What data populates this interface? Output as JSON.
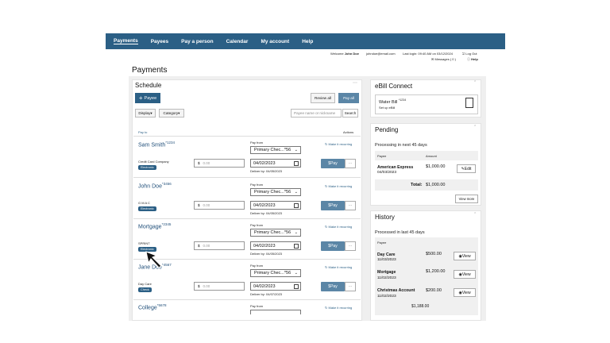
{
  "nav": [
    "Payments",
    "Payees",
    "Pay a person",
    "Calendar",
    "My account",
    "Help"
  ],
  "util": {
    "welcome_prefix": "Welcome",
    "welcome_name": "John Doe",
    "email": "johndoe@email.com",
    "last_login": "Last login: 09:40 AM on 03/12/2024",
    "logout": "Log Out",
    "messages": "Messages ( 0 )",
    "help": "Help"
  },
  "page_title": "Payments",
  "schedule": {
    "title": "Schedule",
    "add_payee": "Payee",
    "review_all": "Review all",
    "pay_all": "Pay all",
    "display": "Display",
    "category": "Category",
    "search_placeholder": "Payee name or nickname",
    "search_button": "Search",
    "col_pay_to": "Pay to",
    "col_actions": "Actions",
    "payees": [
      {
        "name": "Sam Smith",
        "acct": "*1234",
        "company": "Credit Card Company",
        "badge": "Electronic",
        "pay_from_label": "Pay from",
        "account": "Primary Chec...*56",
        "amount_placeholder": "0.00",
        "date": "04/02/2023",
        "deliver": "Deliver by: 04/05/2023",
        "pay": "Pay",
        "recurring": "Make it recurring"
      },
      {
        "name": "John Doe",
        "acct": "*3456",
        "company": "G M A C",
        "badge": "Electronic",
        "pay_from_label": "Pay from",
        "account": "Primary Chec...*56",
        "amount_placeholder": "0.00",
        "date": "04/02/2023",
        "deliver": "Deliver by: 04/05/2023",
        "pay": "Pay",
        "recurring": "Make it recurring"
      },
      {
        "name": "Mortgage",
        "acct": "*2345",
        "company": "SPRINT",
        "badge": "Electronic",
        "pay_from_label": "Pay from",
        "account": "Primary Chec...*56",
        "amount_placeholder": "0.00",
        "date": "04/02/2023",
        "deliver": "Deliver by: 04/05/2023",
        "pay": "Pay",
        "recurring": "Make it recurring"
      },
      {
        "name": "Jane Doe",
        "acct": "*4567",
        "company": "Day Care",
        "badge": "Check",
        "pay_from_label": "Pay from",
        "account": "Primary Chec...*56",
        "amount_placeholder": "0.00",
        "date": "04/02/2023",
        "deliver": "Deliver by: 04/07/2023",
        "pay": "Pay",
        "recurring": "Make it recurring"
      },
      {
        "name": "College",
        "acct": "*5678",
        "pay_from_label": "Pay from",
        "recurring": "Make it recurring"
      }
    ]
  },
  "ebill": {
    "title": "eBill Connect",
    "water_bill": "Water Bill",
    "water_acct": "*1234",
    "setup": "Set up eBill"
  },
  "pending": {
    "title": "Pending",
    "subtitle": "Processing in next 45 days",
    "col_payee": "Payee",
    "col_amount": "Amount",
    "item_name": "American Express",
    "item_date": "04/03/2023",
    "item_amount": "$1,000.00",
    "edit": "Edit",
    "total_label": "Total:",
    "total_amount": "$1,000.00",
    "view_more": "View more"
  },
  "history": {
    "title": "History",
    "subtitle": "Processed in last 45 days",
    "col_payee": "Payee",
    "view": "View",
    "items": [
      {
        "name": "Day Care",
        "date": "11/03/2023",
        "amount": "$500.00"
      },
      {
        "name": "Mortgage",
        "date": "11/02/2023",
        "amount": "$1,200.00"
      },
      {
        "name": "Christmas Account",
        "date": "11/02/2023",
        "amount": "$200.00"
      }
    ],
    "total": "$1,188.00"
  },
  "colors": {
    "nav": "#2b5f85",
    "pay_button": "#5b86a6",
    "link": "#1f4e79"
  }
}
